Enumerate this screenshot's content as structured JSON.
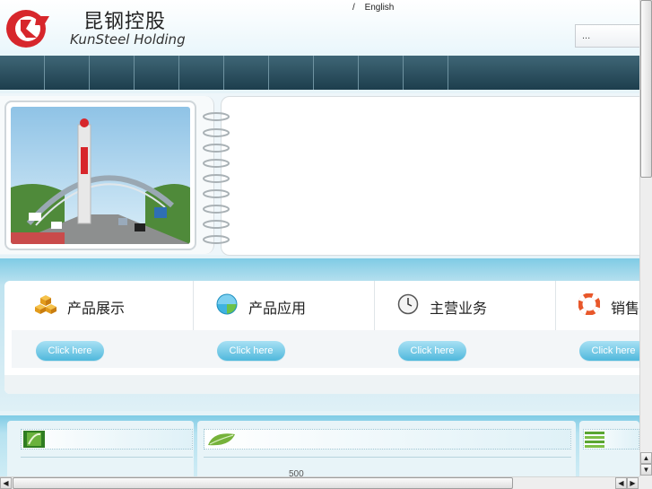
{
  "brand": {
    "name_cn": "昆钢控股",
    "name_en": "KunSteel Holding",
    "logo_color": "#d7262b"
  },
  "top_links": {
    "separator": "/",
    "english": "English"
  },
  "search": {
    "value": "..."
  },
  "nav": {
    "bar_color": "#2a4f5f",
    "items": [
      "",
      "",
      "",
      "",
      "",
      "",
      "",
      "",
      "",
      "",
      ""
    ]
  },
  "features": [
    {
      "title": "产品展示",
      "button": "Click here",
      "icon": "cubes-icon"
    },
    {
      "title": "产品应用",
      "button": "Click here",
      "icon": "globe-icon"
    },
    {
      "title": "主营业务",
      "button": "Click here",
      "icon": "clock-icon"
    },
    {
      "title": "销售",
      "button": "Click here",
      "icon": "lifebuoy-icon"
    }
  ],
  "lower": {
    "text": "500"
  },
  "colors": {
    "accent": "#4fb8dc",
    "band": "#7fcbe5"
  }
}
